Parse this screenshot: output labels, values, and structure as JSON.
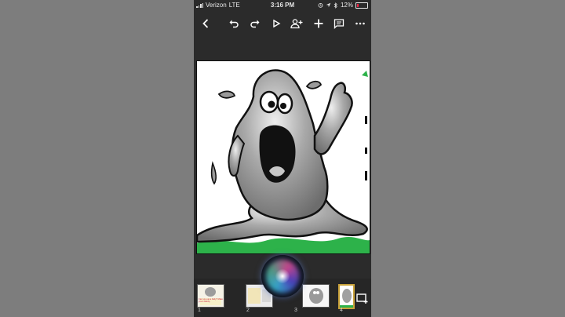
{
  "status": {
    "carrier": "Verizon",
    "network": "LTE",
    "time": "3:16 PM",
    "battery": "12%",
    "icons": [
      "signal-icon",
      "alarm-icon",
      "location-icon",
      "bluetooth-icon",
      "battery-icon"
    ]
  },
  "toolbar": {
    "icons": [
      "back-icon",
      "undo-icon",
      "redo-icon",
      "present-icon",
      "add-person-icon",
      "add-icon",
      "comment-icon",
      "more-icon"
    ]
  },
  "slide": {
    "image": "gray-blob-monster-cartoon"
  },
  "filmstrip": {
    "slides": [
      {
        "number": "1",
        "caption": "Can you eat a baby? Make you a blobby"
      },
      {
        "number": "2"
      },
      {
        "number": "3"
      },
      {
        "number": "4",
        "selected": true
      }
    ]
  },
  "colors": {
    "background": "#7d7d7d",
    "app_background": "#2b2b2b",
    "selection": "#c9a23a",
    "slime_green": "#2db24a"
  }
}
